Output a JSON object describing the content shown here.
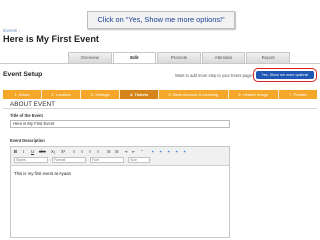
{
  "callout": {
    "text": "Click on “Yes, Show me more options!”"
  },
  "breadcrumb": "Events ›",
  "page_title": "Here is My First Event",
  "tabs": [
    {
      "label": "Overview"
    },
    {
      "label": "Edit"
    },
    {
      "label": "Promote"
    },
    {
      "label": "Attendee"
    },
    {
      "label": "Report"
    }
  ],
  "active_tab": "Edit",
  "event_setup": {
    "title": "Event Setup",
    "prompt": "Want to add more step to your Event page?",
    "show_more_button": "Yes, Show me more options!"
  },
  "steps": [
    {
      "label": "1. About"
    },
    {
      "label": "2. Location"
    },
    {
      "label": "3. Settings"
    },
    {
      "label": "4. Tickets"
    },
    {
      "label": "5. Bank Account & Invoicing"
    },
    {
      "label": "6. Header Image"
    },
    {
      "label": "7. Publish"
    }
  ],
  "active_step": "4. Tickets",
  "about_section": {
    "heading": "ABOUT EVENT",
    "title_label": "Title of the Event",
    "title_value": "Here is My First Event",
    "description_label": "Event Description",
    "description_text": "This is my first event at Ayaan",
    "toolbar_row1": [
      "B",
      "I",
      "U",
      "abc",
      "X₂",
      "X²",
      "≡",
      "≡",
      "≡",
      "≡",
      "☰",
      "☰",
      "⇥",
      "⇤",
      "“",
      "✦",
      "✦",
      "✦",
      "✦",
      "✦"
    ],
    "selects": [
      "Styles",
      "Format",
      "Font",
      "Size"
    ]
  }
}
